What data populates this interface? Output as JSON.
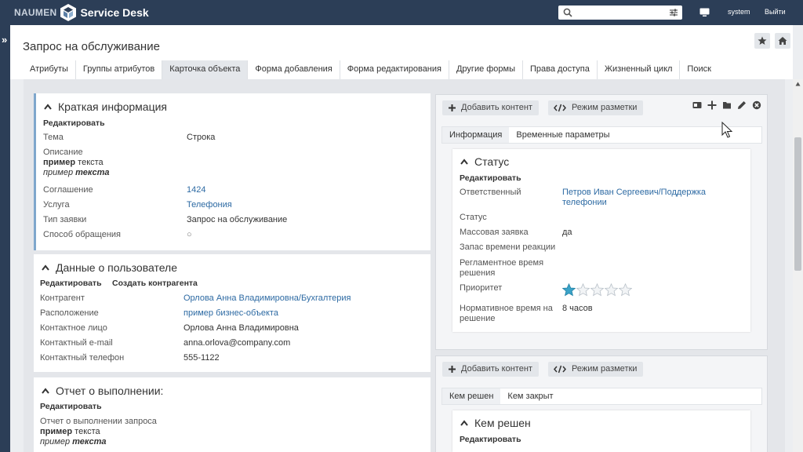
{
  "topbar": {
    "brand": "NAUMEN",
    "product": "Service Desk",
    "search_placeholder": "",
    "user": "system",
    "logout": "Выйти"
  },
  "page": {
    "title": "Запрос на обслуживание"
  },
  "tabs": [
    "Атрибуты",
    "Группы атрибутов",
    "Карточка объекта",
    "Форма добавления",
    "Форма редактирования",
    "Другие формы",
    "Права доступа",
    "Жизненный цикл",
    "Поиск"
  ],
  "active_tab": "Карточка объекта",
  "brief": {
    "title": "Краткая информация",
    "edit": "Редактировать",
    "rows": {
      "theme_label": "Тема",
      "theme_value": "Строка",
      "desc_label": "Описание",
      "desc_b1": "пример",
      "desc_t1": " текста",
      "desc_i1": "пример ",
      "desc_bi1": "текста",
      "agreement_label": "Соглашение",
      "agreement_value": "1424",
      "service_label": "Услуга",
      "service_value": "Телефония",
      "type_label": "Тип заявки",
      "type_value": "Запрос на обслуживание",
      "channel_label": "Способ обращения",
      "channel_value": "○"
    }
  },
  "user_data": {
    "title": "Данные о пользователе",
    "edit": "Редактировать",
    "create_contractor": "Создать контрагента",
    "contractor_label": "Контрагент",
    "contractor_value": "Орлова Анна Владимировна/Бухгалтерия",
    "location_label": "Расположение",
    "location_value": "пример бизнес-объекта",
    "contact_label": "Контактное лицо",
    "contact_value": "Орлова Анна Владимировна",
    "email_label": "Контактный e-mail",
    "email_value": "anna.orlova@company.com",
    "phone_label": "Контактный телефон",
    "phone_value": "555-1122"
  },
  "report": {
    "title": "Отчет о выполнении:",
    "edit": "Редактировать",
    "label": "Отчет о выполнении запроса",
    "b1": "пример",
    "t1": " текста",
    "i1": "пример ",
    "bi1": "текста"
  },
  "right_top": {
    "add_content": "Добавить контент",
    "markup_mode": "Режим разметки",
    "tabs": [
      "Информация",
      "Временные параметры"
    ],
    "status": {
      "title": "Статус",
      "edit": "Редактировать",
      "responsible_label": "Ответственный",
      "responsible_value_1": "Петров Иван Сергеевич/Поддержка",
      "responsible_value_2": "телефонии",
      "status_label": "Статус",
      "mass_label": "Массовая заявка",
      "mass_value": "да",
      "reserve_label": "Запас времени реакции",
      "regl_label_1": "Регламентное время",
      "regl_label_2": "решения",
      "priority_label": "Приоритет",
      "priority_rating": 1,
      "priority_max": 5,
      "norm_label_1": "Нормативное время на",
      "norm_label_2": "решение",
      "norm_value": "8 часов"
    }
  },
  "right_bottom": {
    "add_content": "Добавить контент",
    "markup_mode": "Режим разметки",
    "tabs": [
      "Кем решен",
      "Кем закрыт"
    ],
    "section_title": "Кем решен",
    "edit": "Редактировать"
  },
  "colors": {
    "topbar": "#2c3e57",
    "link": "#2d6aa3",
    "accent": "#7fa7cc",
    "star_on": "#3ba3c8"
  }
}
